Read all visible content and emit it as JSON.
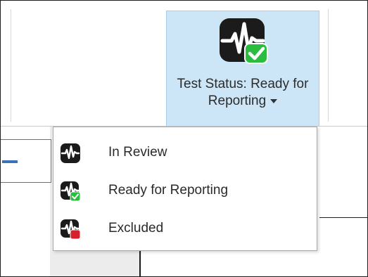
{
  "ribbon": {
    "status_button": {
      "label": "Test Status: Ready for Reporting",
      "icon": "waveform-check-icon",
      "background": "#cde6f7"
    }
  },
  "status_menu": {
    "items": [
      {
        "label": "In Review",
        "icon": "waveform-icon"
      },
      {
        "label": "Ready for Reporting",
        "icon": "waveform-check-icon"
      },
      {
        "label": "Excluded",
        "icon": "waveform-excluded-icon"
      }
    ]
  },
  "colors": {
    "check": "#2bbd3f",
    "excluded": "#d6202b",
    "icon_tile": "#1b1b1b"
  }
}
